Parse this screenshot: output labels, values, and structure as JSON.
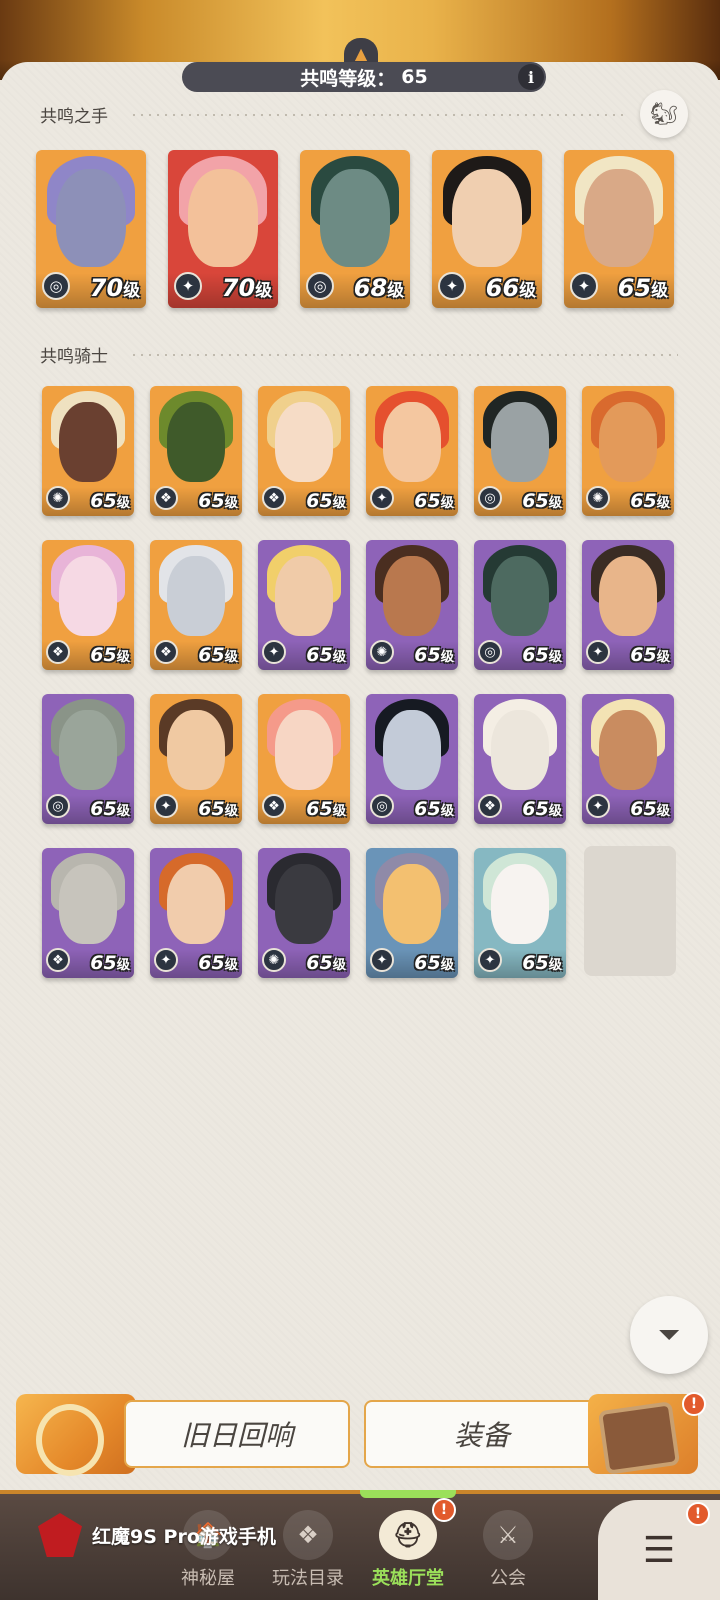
{
  "header": {
    "level_label": "共鸣等级：",
    "level_value": "65",
    "info_label": "i"
  },
  "sections": {
    "hands_title": "共鸣之手",
    "knights_title": "共鸣骑士"
  },
  "level_suffix": "级",
  "hands": [
    {
      "level": "70",
      "bg": "#f0a040",
      "hair": "#8f86c8",
      "skin": "#8d90b8",
      "faction": "◎"
    },
    {
      "level": "70",
      "bg": "#d9463a",
      "hair": "#f2a3a8",
      "skin": "#f3c19a",
      "faction": "✦"
    },
    {
      "level": "68",
      "bg": "#f0a040",
      "hair": "#2a4a40",
      "skin": "#6d8b84",
      "faction": "◎"
    },
    {
      "level": "66",
      "bg": "#f0a040",
      "hair": "#1e1a18",
      "skin": "#f0cfb0",
      "faction": "✦"
    },
    {
      "level": "65",
      "bg": "#f0a040",
      "hair": "#f1e6c4",
      "skin": "#d9a987",
      "faction": "✦"
    }
  ],
  "knights": [
    {
      "level": "65",
      "bg": "#f0a040",
      "hair": "#efe1c0",
      "skin": "#6a4030",
      "faction": "✺"
    },
    {
      "level": "65",
      "bg": "#f0a040",
      "hair": "#6d8a2c",
      "skin": "#3f5a2a",
      "faction": "❖"
    },
    {
      "level": "65",
      "bg": "#f0a040",
      "hair": "#f0d08c",
      "skin": "#f6dcc6",
      "faction": "❖"
    },
    {
      "level": "65",
      "bg": "#f0a040",
      "hair": "#e5502e",
      "skin": "#f4c7a0",
      "faction": "✦"
    },
    {
      "level": "65",
      "bg": "#f0a040",
      "hair": "#202624",
      "skin": "#9aa2a4",
      "faction": "◎"
    },
    {
      "level": "65",
      "bg": "#f0a040",
      "hair": "#d96a2e",
      "skin": "#e39a5a",
      "faction": "✺"
    },
    {
      "level": "65",
      "bg": "#f0a040",
      "hair": "#e8b4d8",
      "skin": "#f6d9e4",
      "faction": "❖"
    },
    {
      "level": "65",
      "bg": "#f0a040",
      "hair": "#e2e4e8",
      "skin": "#c9ced6",
      "faction": "❖"
    },
    {
      "level": "65",
      "bg": "#8e63b8",
      "hair": "#f1cf6a",
      "skin": "#f0cba8",
      "faction": "✦"
    },
    {
      "level": "65",
      "bg": "#8e63b8",
      "hair": "#4a2e20",
      "skin": "#b9784e",
      "faction": "✺"
    },
    {
      "level": "65",
      "bg": "#8e63b8",
      "hair": "#253a34",
      "skin": "#4d6a60",
      "faction": "◎"
    },
    {
      "level": "65",
      "bg": "#8e63b8",
      "hair": "#3a2c24",
      "skin": "#e8b58a",
      "faction": "✦"
    },
    {
      "level": "65",
      "bg": "#8e63b8",
      "hair": "#8a9488",
      "skin": "#9aa59a",
      "faction": "◎"
    },
    {
      "level": "65",
      "bg": "#f0a040",
      "hair": "#5a3a26",
      "skin": "#f0c9a2",
      "faction": "✦"
    },
    {
      "level": "65",
      "bg": "#f0a040",
      "hair": "#f59a8a",
      "skin": "#f7d6c4",
      "faction": "❖"
    },
    {
      "level": "65",
      "bg": "#8e63b8",
      "hair": "#161a22",
      "skin": "#c3cbd8",
      "faction": "◎"
    },
    {
      "level": "65",
      "bg": "#8e63b8",
      "hair": "#f4eee4",
      "skin": "#ece6dc",
      "faction": "❖"
    },
    {
      "level": "65",
      "bg": "#8e63b8",
      "hair": "#f3e3b4",
      "skin": "#c98c60",
      "faction": "✦"
    },
    {
      "level": "65",
      "bg": "#8e63b8",
      "hair": "#b8b6ae",
      "skin": "#c7c4bc",
      "faction": "❖"
    },
    {
      "level": "65",
      "bg": "#8e63b8",
      "hair": "#d66a2a",
      "skin": "#f1ccac",
      "faction": "✦"
    },
    {
      "level": "65",
      "bg": "#8e63b8",
      "hair": "#2a2a30",
      "skin": "#3a3a40",
      "faction": "✺"
    },
    {
      "level": "65",
      "bg": "#6a94b8",
      "hair": "#8f8aa8",
      "skin": "#f3c070",
      "faction": "✦"
    },
    {
      "level": "65",
      "bg": "#86b8c2",
      "hair": "#cfe6d6",
      "skin": "#f7f3f0",
      "faction": "✦"
    }
  ],
  "buttons": {
    "echo_label": "旧日回响",
    "gear_label": "装备",
    "badge": "!"
  },
  "nav": {
    "items": [
      {
        "label": "神秘屋",
        "icon": "🏠"
      },
      {
        "label": "玩法目录",
        "icon": "❖"
      },
      {
        "label": "英雄厅堂",
        "icon": "⛑"
      },
      {
        "label": "公会",
        "icon": "⚔"
      }
    ],
    "menu_icon": "☰"
  },
  "watermark": "红魔9S Pro游戏手机",
  "icons": {
    "emblem": "helmet-emblem-icon",
    "favorite": "squirrel-icon",
    "filter": "filter-icon",
    "menu": "menu-icon"
  }
}
